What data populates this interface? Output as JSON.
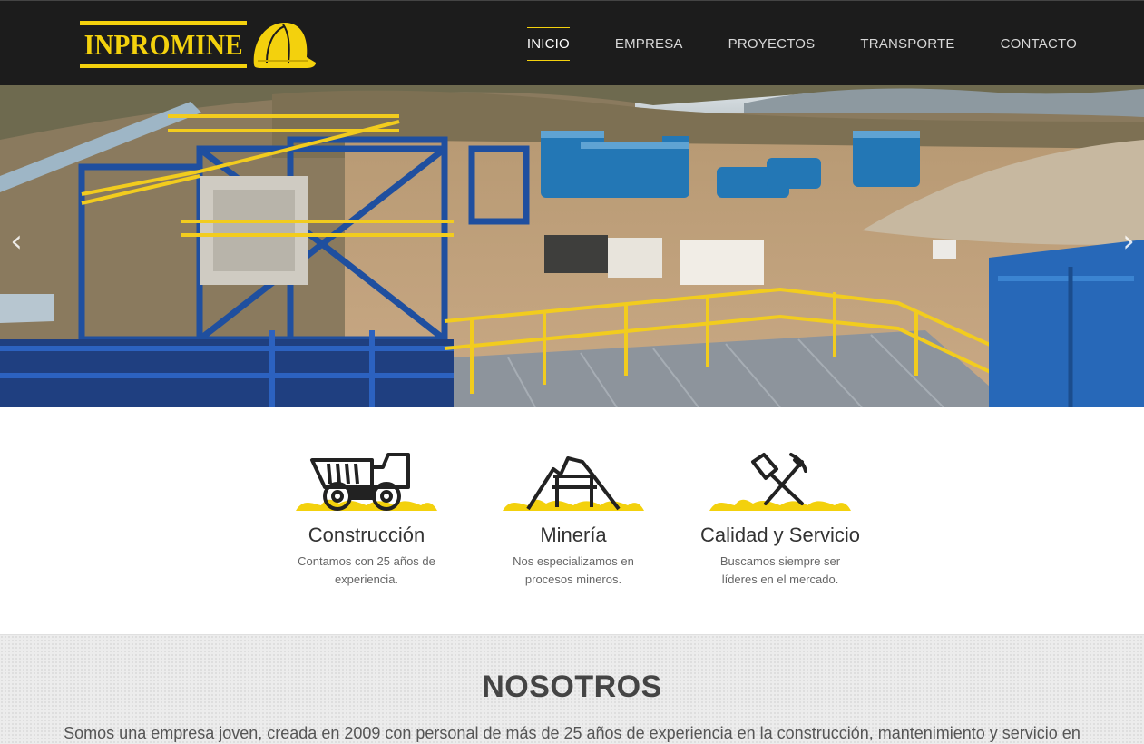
{
  "brand": {
    "name": "INPROMINE",
    "accent": "#f3d10d",
    "helmet_icon": "hard-hat-icon"
  },
  "nav": {
    "items": [
      {
        "label": "INICIO",
        "active": true
      },
      {
        "label": "EMPRESA",
        "active": false
      },
      {
        "label": "PROYECTOS",
        "active": false
      },
      {
        "label": "TRANSPORTE",
        "active": false
      },
      {
        "label": "CONTACTO",
        "active": false
      }
    ]
  },
  "hero": {
    "prev_icon": "chevron-left-icon",
    "next_icon": "chevron-right-icon",
    "prev_glyph": "‹",
    "next_glyph": "›"
  },
  "features": [
    {
      "icon": "dump-truck-icon",
      "title": "Construcción",
      "text": "Contamos con 25 años de experiencia."
    },
    {
      "icon": "mine-entrance-icon",
      "title": "Minería",
      "text": "Nos especializamos en procesos mineros."
    },
    {
      "icon": "shovel-pickaxe-icon",
      "title": "Calidad y Servicio",
      "text": "Buscamos siempre ser líderes en el mercado."
    }
  ],
  "about": {
    "title": "NOSOTROS",
    "text": "Somos una empresa joven, creada en 2009 con personal de más de 25 años de experiencia en la construcción, mantenimiento y servicio en"
  }
}
